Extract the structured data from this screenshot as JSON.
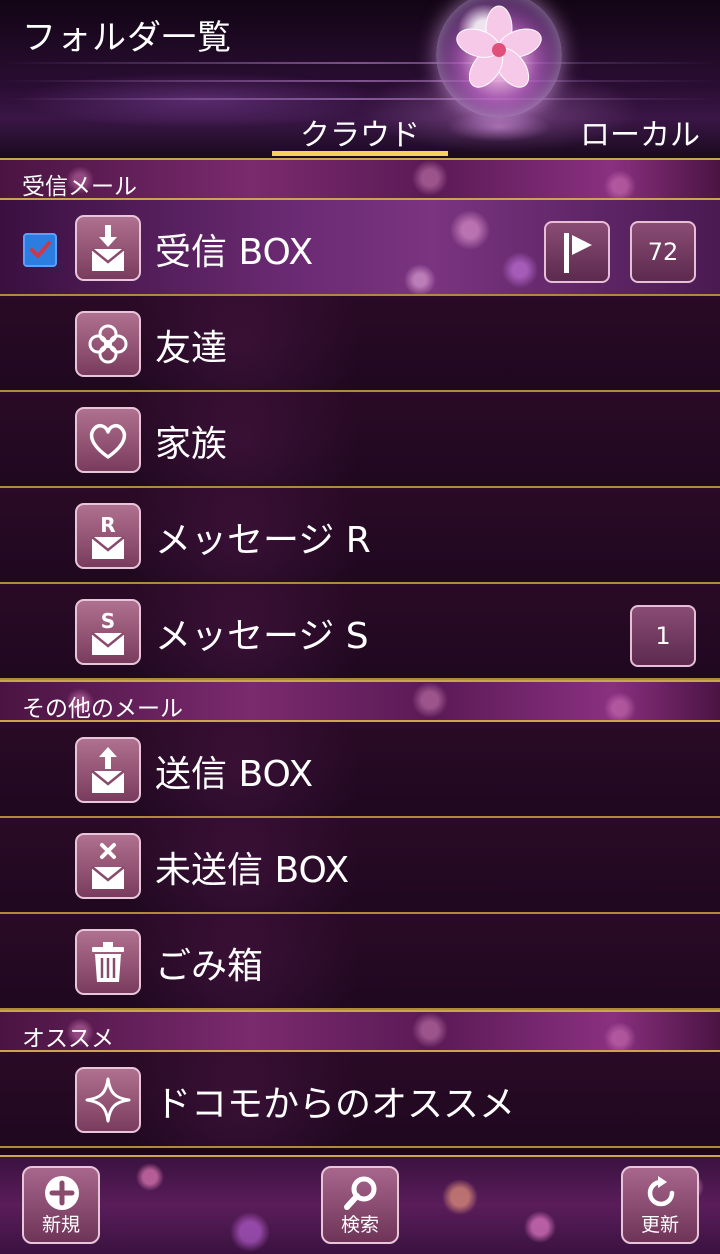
{
  "header": {
    "title": "フォルダ一覧",
    "tabs": [
      {
        "label": "クラウド",
        "selected": true
      },
      {
        "label": "ローカル",
        "selected": false
      }
    ]
  },
  "colors": {
    "accent_gold": "#c9a64d",
    "tab_indicator": "#f3d35c",
    "checkbox_blue": "#2b7de0"
  },
  "sections": [
    {
      "label": "受信メール",
      "items": [
        {
          "label": "受信 BOX",
          "icon": "inbox-download-icon",
          "checked": true,
          "flag": true,
          "count": "72"
        },
        {
          "label": "友達",
          "icon": "clover-icon"
        },
        {
          "label": "家族",
          "icon": "heart-icon"
        },
        {
          "label": "メッセージ R",
          "icon": "mail-r-icon"
        },
        {
          "label": "メッセージ S",
          "icon": "mail-s-icon",
          "count": "1"
        }
      ]
    },
    {
      "label": "その他のメール",
      "items": [
        {
          "label": "送信 BOX",
          "icon": "outbox-upload-icon"
        },
        {
          "label": "未送信 BOX",
          "icon": "mail-x-icon"
        },
        {
          "label": "ごみ箱",
          "icon": "trash-icon"
        }
      ]
    },
    {
      "label": "オススメ",
      "items": [
        {
          "label": "ドコモからのオススメ",
          "icon": "sparkle-icon"
        }
      ]
    }
  ],
  "footer": {
    "new_label": "新規",
    "search_label": "検索",
    "refresh_label": "更新"
  }
}
